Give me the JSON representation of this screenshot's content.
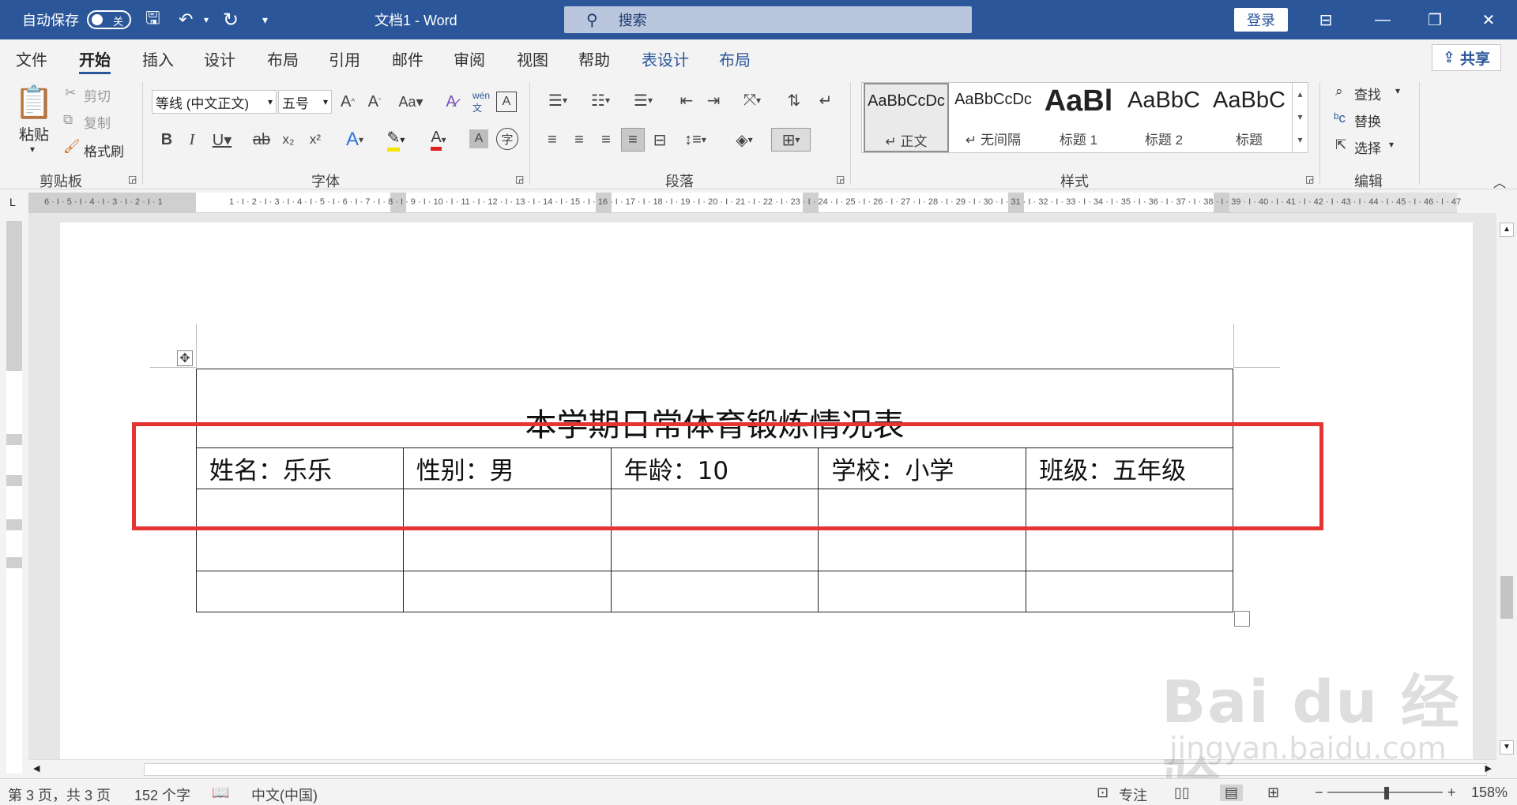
{
  "titlebar": {
    "autosave_label": "自动保存",
    "autosave_state": "关",
    "doc_title": "文档1  -  Word",
    "search_placeholder": "搜索",
    "login_label": "登录"
  },
  "tabs": [
    "文件",
    "开始",
    "插入",
    "设计",
    "布局",
    "引用",
    "邮件",
    "审阅",
    "视图",
    "帮助",
    "表设计",
    "布局"
  ],
  "share_label": "共享",
  "ribbon": {
    "clipboard": {
      "paste": "粘贴",
      "cut": "剪切",
      "copy": "复制",
      "format_painter": "格式刷",
      "label": "剪贴板"
    },
    "font": {
      "font_name": "等线 (中文正文)",
      "font_size": "五号",
      "label": "字体"
    },
    "paragraph": {
      "label": "段落"
    },
    "styles": {
      "label": "样式",
      "items": [
        {
          "sample": "AaBbCcDc",
          "name": "↵ 正文"
        },
        {
          "sample": "AaBbCcDc",
          "name": "↵ 无间隔"
        },
        {
          "sample": "AaBl",
          "name": "标题 1"
        },
        {
          "sample": "AaBbC",
          "name": "标题 2"
        },
        {
          "sample": "AaBbC",
          "name": "标题"
        }
      ]
    },
    "editing": {
      "find": "查找",
      "replace": "替换",
      "select": "选择",
      "label": "编辑"
    }
  },
  "document": {
    "table_title": "本学期日常体育锻炼情况表",
    "header_row": [
      "姓名：乐乐",
      "性别：男",
      "年龄：10",
      "学校：小学",
      "班级：五年级"
    ]
  },
  "status": {
    "page": "第 3 页，共 3 页",
    "words": "152 个字",
    "language": "中文(中国)",
    "focus": "专注",
    "zoom": "158%"
  },
  "watermark": {
    "line1": "Bai du 经验",
    "line2": "jingyan.baidu.com"
  }
}
